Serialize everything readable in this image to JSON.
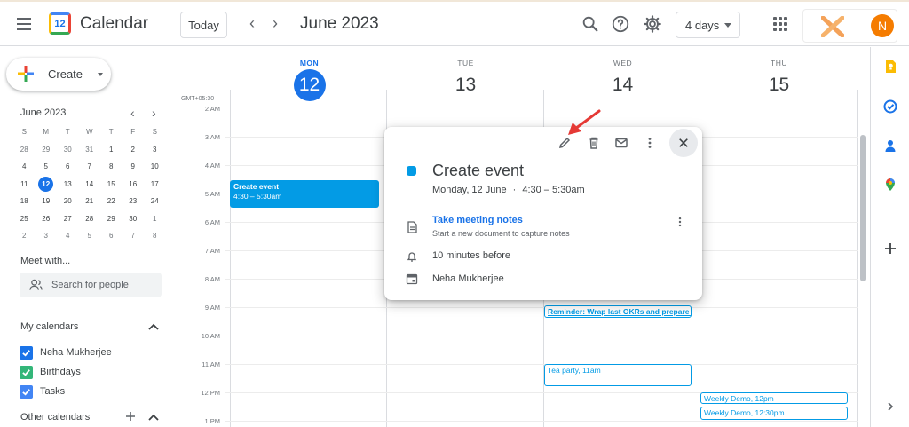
{
  "header": {
    "app_title": "Calendar",
    "logo_text": "12",
    "today_label": "Today",
    "prev_label": "‹",
    "next_label": "›",
    "month_title": "June 2023",
    "view_label": "4 days",
    "avatar_initial": "N",
    "icons": [
      "menu-icon",
      "search-icon",
      "help-icon",
      "settings-icon",
      "apps-icon"
    ]
  },
  "sidebar": {
    "create_label": "Create",
    "mini_calendar": {
      "title": "June 2023",
      "prev": "‹",
      "next": "›",
      "weekdays": [
        "S",
        "M",
        "T",
        "W",
        "T",
        "F",
        "S"
      ],
      "weeks": [
        [
          "28",
          "29",
          "30",
          "31",
          "1",
          "2",
          "3"
        ],
        [
          "4",
          "5",
          "6",
          "7",
          "8",
          "9",
          "10"
        ],
        [
          "11",
          "12",
          "13",
          "14",
          "15",
          "16",
          "17"
        ],
        [
          "18",
          "19",
          "20",
          "21",
          "22",
          "23",
          "24"
        ],
        [
          "25",
          "26",
          "27",
          "28",
          "29",
          "30",
          "1"
        ],
        [
          "2",
          "3",
          "4",
          "5",
          "6",
          "7",
          "8"
        ]
      ],
      "selected": "12"
    },
    "meet_title": "Meet with...",
    "search_placeholder": "Search for people",
    "my_calendars_title": "My calendars",
    "my_calendars_chevron": "^",
    "calendars": [
      {
        "label": "Neha Mukherjee",
        "color": "#1a73e8"
      },
      {
        "label": "Birthdays",
        "color": "#33b679"
      },
      {
        "label": "Tasks",
        "color": "#4285f4"
      }
    ],
    "other_calendars_title": "Other calendars",
    "other_plus": "+",
    "other_chevron": "^"
  },
  "grid": {
    "timezone": "GMT+05:30",
    "days": [
      {
        "dow": "MON",
        "num": "12",
        "today": true
      },
      {
        "dow": "TUE",
        "num": "13",
        "today": false
      },
      {
        "dow": "WED",
        "num": "14",
        "today": false
      },
      {
        "dow": "THU",
        "num": "15",
        "today": false
      }
    ],
    "hours": [
      "2 AM",
      "3 AM",
      "4 AM",
      "5 AM",
      "6 AM",
      "7 AM",
      "8 AM",
      "9 AM",
      "10 AM",
      "11 AM",
      "12 PM",
      "1 PM"
    ],
    "events": {
      "create_event": {
        "title": "Create event",
        "time": "4:30 – 5:30am"
      },
      "reminder": {
        "title": "Reminder: Wrap last OKRs and prepare n"
      },
      "tea_party": {
        "title": "Tea party,",
        "time": "11am"
      },
      "weekly_demo_1": {
        "title": "Weekly Demo,",
        "time": "12pm"
      },
      "weekly_demo_2": {
        "title": "Weekly Demo,",
        "time": "12:30pm"
      }
    }
  },
  "popup": {
    "title": "Create event",
    "date": "Monday, 12 June",
    "separator": "·",
    "time_range": "4:30 – 5:30am",
    "notes_link": "Take meeting notes",
    "notes_sub": "Start a new document to capture notes",
    "reminder": "10 minutes before",
    "owner": "Neha Mukherjee",
    "toolbar_icons": [
      "edit-icon",
      "delete-icon",
      "email-icon",
      "more-options-icon",
      "close-icon"
    ]
  },
  "colors": {
    "accent": "#1a73e8",
    "event": "#039be5",
    "avatar": "#f57c00",
    "annotation_arrow": "#e53935"
  }
}
